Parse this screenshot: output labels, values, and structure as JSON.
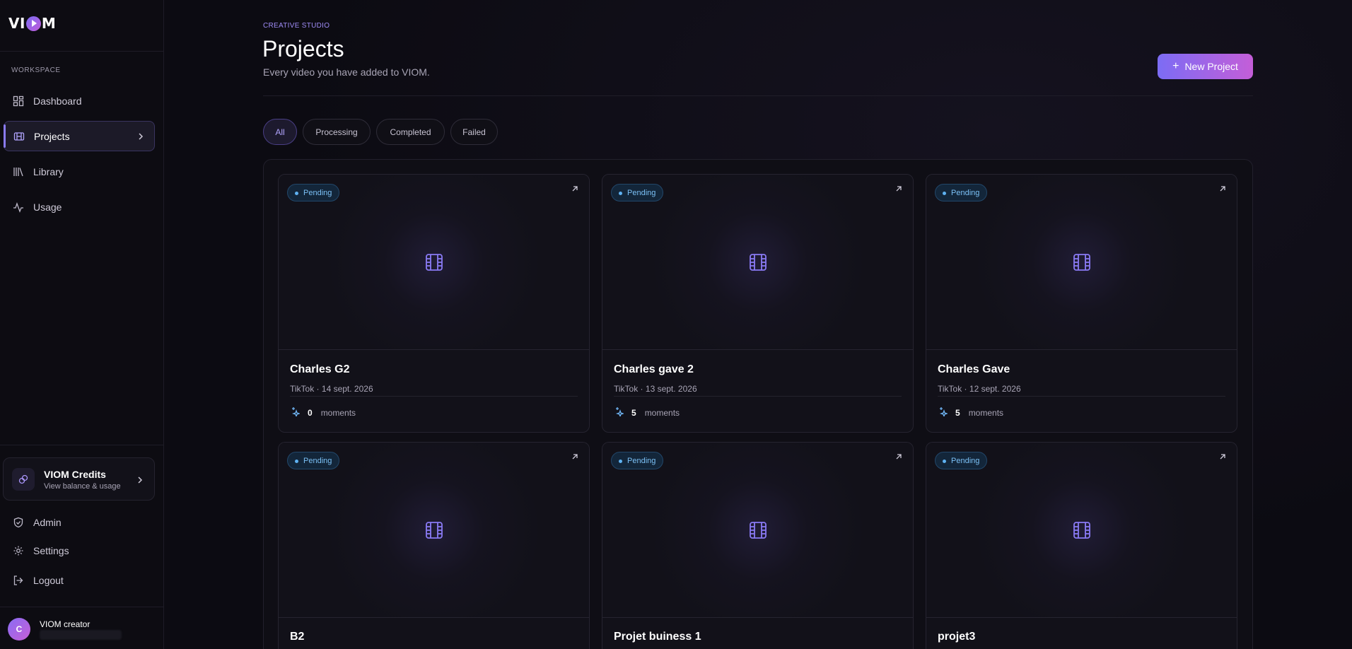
{
  "app": {
    "logo_text_left": "VI",
    "logo_text_right": "M"
  },
  "sidebar": {
    "section_label": "WORKSPACE",
    "items": [
      {
        "label": "Dashboard",
        "icon": "dashboard-icon"
      },
      {
        "label": "Projects",
        "icon": "projects-icon",
        "active": true
      },
      {
        "label": "Library",
        "icon": "library-icon"
      },
      {
        "label": "Usage",
        "icon": "usage-icon"
      }
    ],
    "credits": {
      "title": "VIOM Credits",
      "subtitle": "View balance & usage"
    },
    "bottom_items": [
      {
        "label": "Admin",
        "icon": "shield-icon"
      },
      {
        "label": "Settings",
        "icon": "gear-icon"
      },
      {
        "label": "Logout",
        "icon": "logout-icon"
      }
    ],
    "user": {
      "initial": "C",
      "name": "VIOM creator"
    }
  },
  "header": {
    "eyebrow": "CREATIVE STUDIO",
    "title": "Projects",
    "subtitle": "Every video you have added to VIOM.",
    "new_button_label": "New Project"
  },
  "filters": [
    "All",
    "Processing",
    "Completed",
    "Failed"
  ],
  "active_filter": "All",
  "projects": [
    {
      "title": "Charles G2",
      "meta": "TikTok · 14 sept. 2026",
      "moments": "0",
      "moments_label": "moments",
      "status": "Pending"
    },
    {
      "title": "Charles gave 2",
      "meta": "TikTok · 13 sept. 2026",
      "moments": "5",
      "moments_label": "moments",
      "status": "Pending"
    },
    {
      "title": "Charles Gave",
      "meta": "TikTok · 12 sept. 2026",
      "moments": "5",
      "moments_label": "moments",
      "status": "Pending"
    },
    {
      "title": "B2",
      "meta": "",
      "moments": "",
      "moments_label": "",
      "status": "Pending"
    },
    {
      "title": "Projet buiness 1",
      "meta": "",
      "moments": "",
      "moments_label": "",
      "status": "Pending"
    },
    {
      "title": "projet3",
      "meta": "",
      "moments": "",
      "moments_label": "",
      "status": "Pending"
    }
  ],
  "colors": {
    "accent": "#8a7bf5",
    "accent_end": "#c45ed8",
    "pending_badge": "#7bc0f5",
    "background": "#0c0b12"
  }
}
